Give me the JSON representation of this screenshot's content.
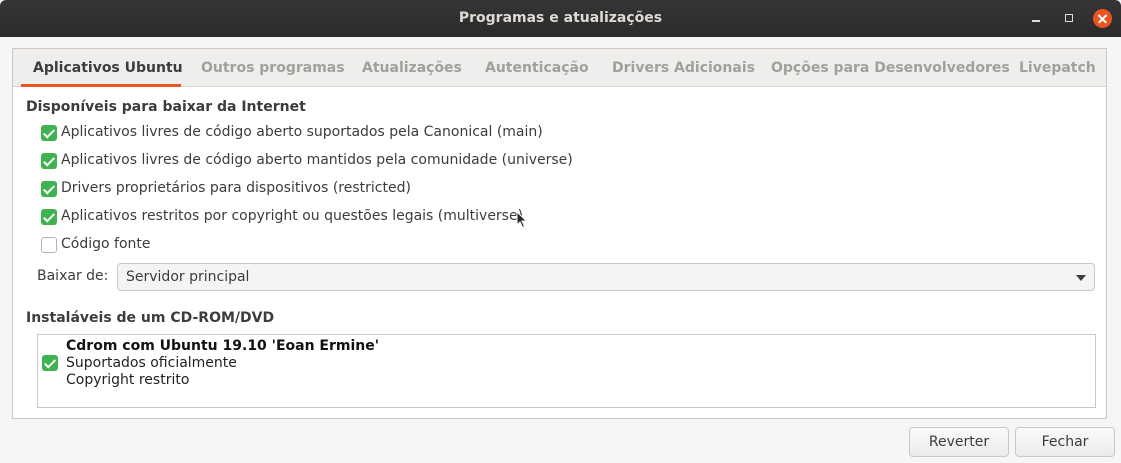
{
  "window": {
    "title": "Programas e atualizações"
  },
  "tabs": [
    {
      "label": "Aplicativos Ubuntu",
      "active": true
    },
    {
      "label": "Outros programas",
      "active": false
    },
    {
      "label": "Atualizações",
      "active": false
    },
    {
      "label": "Autenticação",
      "active": false
    },
    {
      "label": "Drivers Adicionais",
      "active": false
    },
    {
      "label": "Opções para Desenvolvedores",
      "active": false
    },
    {
      "label": "Livepatch",
      "active": false
    }
  ],
  "internet": {
    "title": "Disponíveis para baixar da Internet",
    "options": [
      {
        "label": "Aplicativos livres de código aberto suportados pela Canonical (main)",
        "checked": true
      },
      {
        "label": "Aplicativos livres de código aberto mantidos pela comunidade (universe)",
        "checked": true
      },
      {
        "label": "Drivers proprietários para dispositivos (restricted)",
        "checked": true
      },
      {
        "label": "Aplicativos restritos por copyright ou questões legais (multiverse)",
        "checked": true
      },
      {
        "label": "Código fonte",
        "checked": false
      }
    ],
    "download_from_label": "Baixar de:",
    "download_from_value": "Servidor principal"
  },
  "cdrom": {
    "title": "Instaláveis de um CD-ROM/DVD",
    "item": {
      "name": "Cdrom com Ubuntu 19.10 'Eoan Ermine'",
      "line2": "Suportados oficialmente",
      "line3": "Copyright restrito",
      "checked": true
    }
  },
  "footer": {
    "revert_label": "Reverter",
    "close_label": "Fechar"
  },
  "colors": {
    "accent": "#e95420",
    "check": "#3eb34f",
    "titlebar": "#2f2f2f"
  }
}
